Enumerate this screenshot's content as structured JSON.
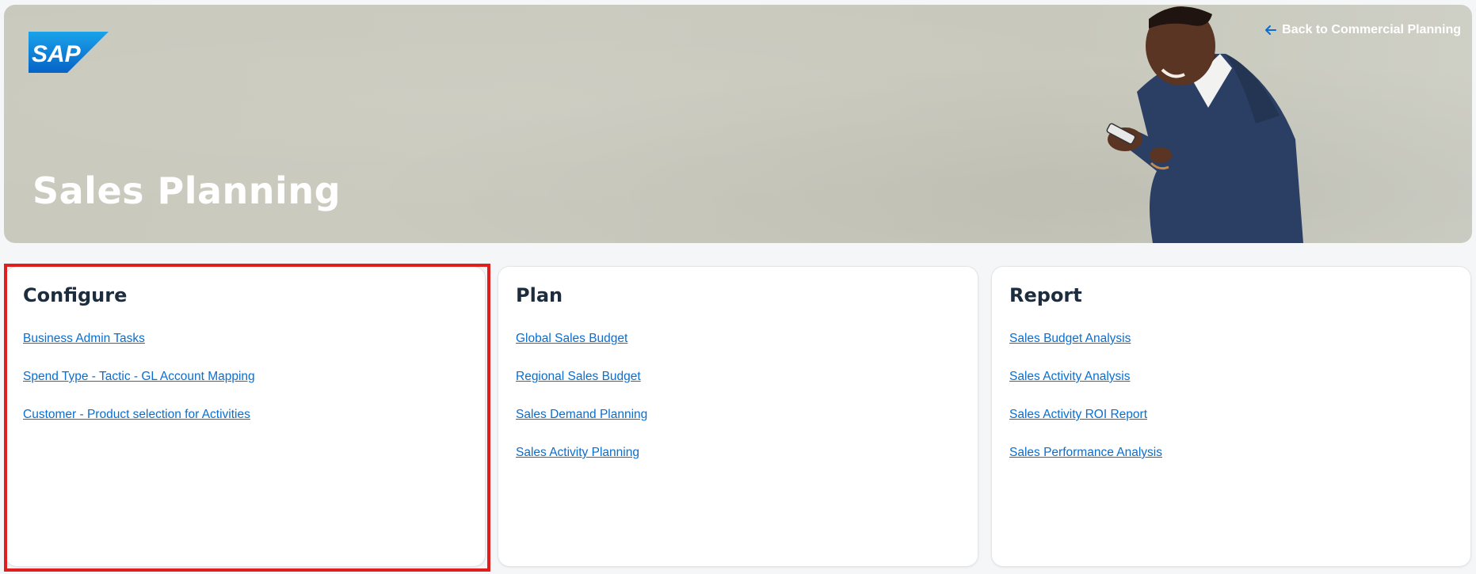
{
  "header": {
    "title": "Sales Planning",
    "back_link": "Back to Commercial Planning",
    "logo_text": "SAP"
  },
  "cards": {
    "configure": {
      "title": "Configure",
      "links": [
        "Business Admin Tasks",
        "Spend Type - Tactic - GL Account Mapping",
        "Customer - Product selection for Activities"
      ]
    },
    "plan": {
      "title": "Plan",
      "links": [
        "Global Sales Budget",
        "Regional Sales Budget",
        "Sales Demand Planning",
        "Sales Activity Planning"
      ]
    },
    "report": {
      "title": "Report",
      "links": [
        "Sales Budget Analysis",
        "Sales Activity Analysis",
        "Sales Activity ROI Report",
        "Sales Performance Analysis"
      ]
    }
  },
  "colors": {
    "link": "#0a6ed1",
    "highlight": "#e01e1e",
    "sap_blue": "#0a7fd6"
  },
  "icons": {
    "back": "arrow-left-icon"
  }
}
